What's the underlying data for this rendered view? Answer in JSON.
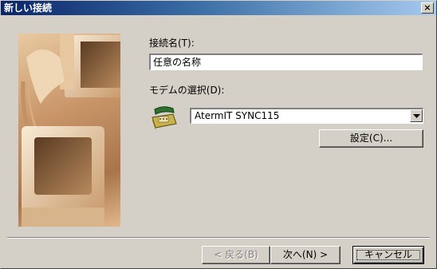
{
  "window": {
    "title": "新しい接続",
    "close_label": "×"
  },
  "form": {
    "name_label": "接続名(T):",
    "name_value": "任意の名称",
    "modem_label": "モデムの選択(D):",
    "modem_value": "AtermIT SYNC115",
    "settings_button": "設定(C)..."
  },
  "footer": {
    "back_button": "< 戻る(B)",
    "next_button": "次へ(N) >",
    "cancel_button": "キャンセル"
  },
  "icons": {
    "modem": "modem-phone-icon",
    "dropdown": "chevron-down-icon",
    "close": "close-icon"
  },
  "colors": {
    "titlebar_start": "#0a246a",
    "titlebar_end": "#a6caf0",
    "dialog_bg": "#d4d0c8"
  }
}
